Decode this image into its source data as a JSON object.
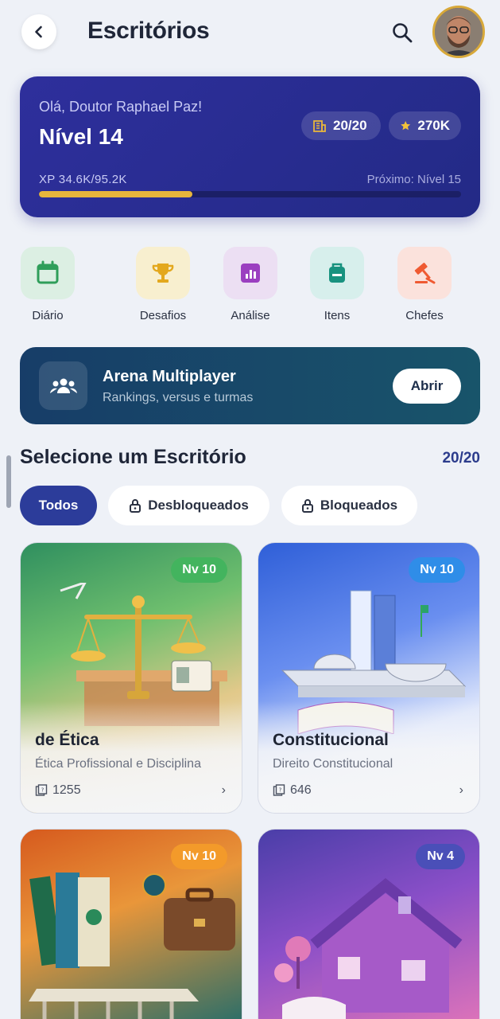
{
  "header": {
    "title": "Escritórios"
  },
  "profile": {
    "greeting": "Olá, Doutor Raphael Paz!",
    "level": "Nível 14",
    "offices_chip": "20/20",
    "points_chip": "270K",
    "xp": "XP 34.6K/95.2K",
    "next": "Próximo: Nível 15",
    "xp_progress": 0.364
  },
  "shortcuts": [
    {
      "label": "Diário",
      "icon": "calendar-icon",
      "bg": "#dcefe3",
      "color": "#2f9e5a"
    },
    {
      "label": "Desafios",
      "icon": "trophy-icon",
      "bg": "#f8efcf",
      "color": "#e3a81e"
    },
    {
      "label": "Análise",
      "icon": "chart-icon",
      "bg": "#ecdff3",
      "color": "#9b3fc0"
    },
    {
      "label": "Itens",
      "icon": "bag-icon",
      "bg": "#d7efec",
      "color": "#18927f"
    },
    {
      "label": "Chefes",
      "icon": "gavel-icon",
      "bg": "#fbe2dc",
      "color": "#ef5a32"
    }
  ],
  "arena": {
    "title": "Arena Multiplayer",
    "subtitle": "Rankings, versus e turmas",
    "button": "Abrir"
  },
  "section": {
    "title": "Selecione um Escritório",
    "count": "20/20"
  },
  "filters": {
    "all": "Todos",
    "unlocked": "Desbloqueados",
    "locked": "Bloqueados"
  },
  "cards": [
    {
      "badge": "Nv 10",
      "title": "de Ética",
      "subtitle": "Ética Profissional e Disciplina",
      "count": "1255"
    },
    {
      "badge": "Nv 10",
      "title": "Constitucional",
      "subtitle": "Direito Constitucional",
      "count": "646"
    },
    {
      "badge": "Nv 10"
    },
    {
      "badge": "Nv 4"
    }
  ]
}
